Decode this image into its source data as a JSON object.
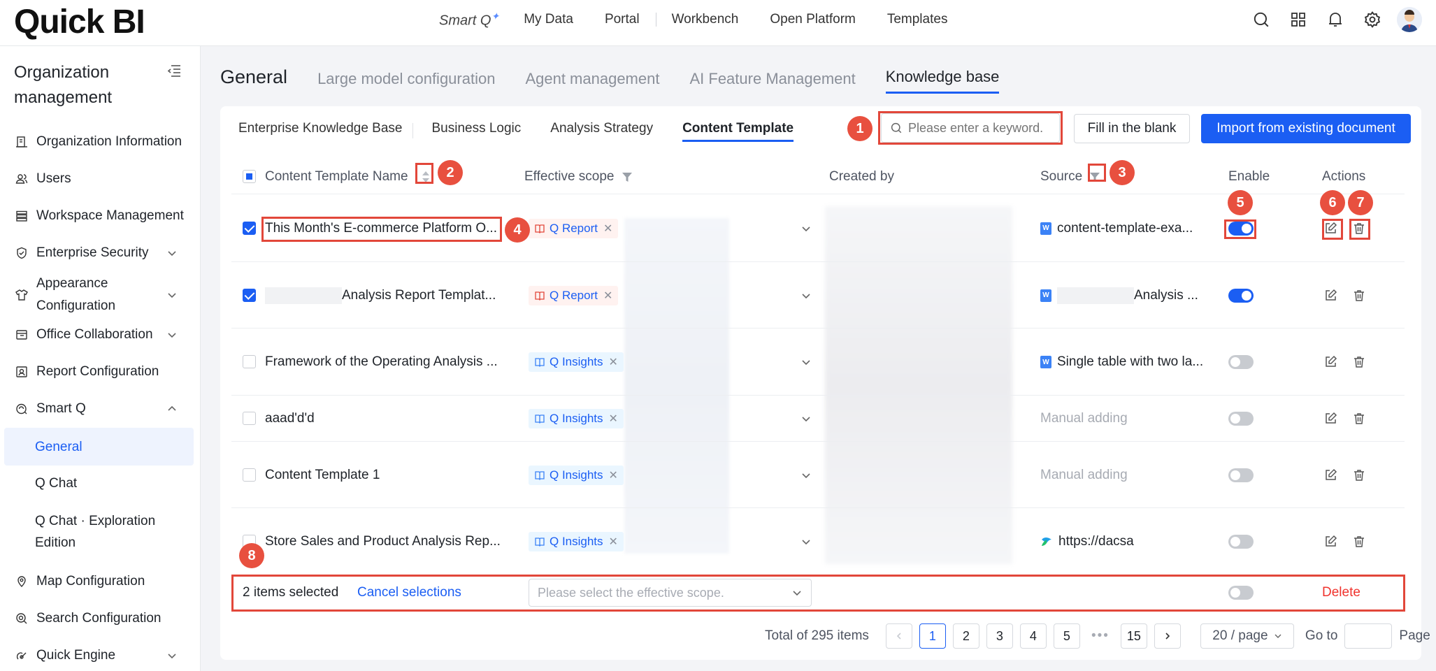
{
  "app": {
    "logo": "Quick BI"
  },
  "topnav": {
    "smartq": "Smart Q",
    "items": [
      "My Data",
      "Portal",
      "Workbench",
      "Open Platform",
      "Templates"
    ]
  },
  "sidebar": {
    "title": "Organization management",
    "items": [
      {
        "label": "Organization Information",
        "icon": "org-info-icon"
      },
      {
        "label": "Users",
        "icon": "users-icon"
      },
      {
        "label": "Workspace Management",
        "icon": "workspace-icon"
      },
      {
        "label": "Enterprise Security",
        "icon": "shield-icon",
        "expand": "down"
      },
      {
        "label": "Appearance Configuration",
        "icon": "shirt-icon",
        "expand": "down"
      },
      {
        "label": "Office Collaboration",
        "icon": "collab-icon",
        "expand": "down"
      },
      {
        "label": "Report Configuration",
        "icon": "report-config-icon"
      },
      {
        "label": "Smart Q",
        "icon": "smartq-icon",
        "expand": "up"
      }
    ],
    "subitems": [
      "General",
      "Q Chat",
      "Q Chat · Exploration Edition"
    ],
    "items_after": [
      {
        "label": "Map Configuration",
        "icon": "map-icon"
      },
      {
        "label": "Search Configuration",
        "icon": "search-config-icon"
      },
      {
        "label": "Quick Engine",
        "icon": "engine-icon",
        "expand": "down"
      }
    ]
  },
  "main": {
    "page_title": "General",
    "tabs": [
      "Large model configuration",
      "Agent management",
      "AI Feature Management",
      "Knowledge base"
    ],
    "active_tab": "Knowledge base",
    "subtabs": [
      "Enterprise Knowledge Base",
      "Business Logic",
      "Analysis Strategy",
      "Content Template"
    ],
    "active_subtab": "Content Template",
    "search_placeholder": "Please enter a keyword.",
    "fill_button": "Fill in the blank",
    "import_button": "Import from existing document"
  },
  "table": {
    "headers": {
      "name": "Content Template Name",
      "scope": "Effective scope",
      "creator": "Created by",
      "source": "Source",
      "enable": "Enable",
      "actions": "Actions"
    },
    "rows": [
      {
        "checked": true,
        "name": "This Month's E-commerce Platform O...",
        "scope": "Q Report",
        "source": "content-template-exa...",
        "source_type": "doc",
        "enabled": true
      },
      {
        "checked": true,
        "name": "Analysis Report Templat...",
        "scope": "Q Report",
        "source": "Analysis ...",
        "source_type": "doc",
        "enabled": true
      },
      {
        "checked": false,
        "name": "Framework of the Operating Analysis ...",
        "scope": "Q Insights",
        "source": "Single table with two la...",
        "source_type": "doc",
        "enabled": false
      },
      {
        "checked": false,
        "name": "aaad'd'd",
        "scope": "Q Insights",
        "source": "Manual adding",
        "source_type": "manual",
        "enabled": false
      },
      {
        "checked": false,
        "name": "Content Template 1",
        "scope": "Q Insights",
        "source": "Manual adding",
        "source_type": "manual",
        "enabled": false
      },
      {
        "checked": false,
        "name": "Store Sales and Product Analysis Rep...",
        "scope": "Q Insights",
        "source": "https://dacsa",
        "source_type": "web",
        "enabled": false
      }
    ]
  },
  "selection": {
    "count_text": "2 items selected",
    "cancel": "Cancel selections",
    "scope_placeholder": "Please select the effective scope.",
    "delete": "Delete"
  },
  "pagination": {
    "total": "Total of 295 items",
    "pages": [
      "1",
      "2",
      "3",
      "4",
      "5"
    ],
    "last": "15",
    "current": "1",
    "page_size": "20 / page",
    "goto": "Go to",
    "page_word": "Page"
  },
  "annotations": [
    "1",
    "2",
    "3",
    "4",
    "5",
    "6",
    "7",
    "8"
  ],
  "colors": {
    "accent": "#1b5ef3",
    "annotation": "#e8503f",
    "danger": "#f0342e"
  }
}
